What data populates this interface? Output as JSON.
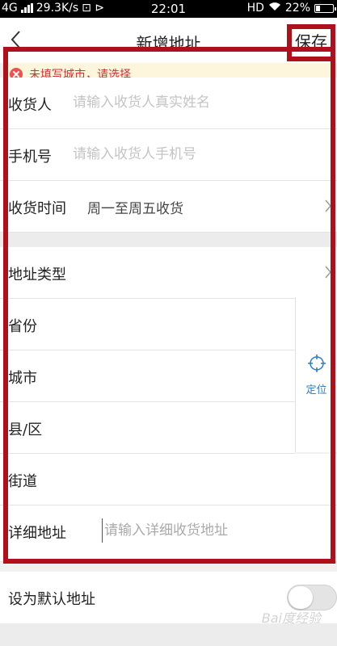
{
  "status_bar": {
    "network": "4G",
    "speed": "29.3K/s",
    "time": "22:01",
    "hd": "HD",
    "battery": "22%",
    "battery_level": 0.22
  },
  "nav": {
    "title": "新增地址",
    "save_label": "保存"
  },
  "error": {
    "message": "未填写城市，请选择"
  },
  "form": {
    "name": {
      "label": "收货人",
      "placeholder": "请输入收货人真实姓名"
    },
    "phone": {
      "label": "手机号",
      "placeholder": "请输入收货人手机号"
    },
    "delivery_time": {
      "label": "收货时间",
      "value": "周一至周五收货"
    },
    "address_type": {
      "label": "地址类型"
    },
    "province": {
      "label": "省份"
    },
    "city": {
      "label": "城市"
    },
    "district": {
      "label": "县/区"
    },
    "street": {
      "label": "街道"
    },
    "detail": {
      "label": "详细地址",
      "placeholder": "请输入详细收货地址"
    },
    "locate_label": "定位"
  },
  "default_address": {
    "label": "设为默认地址",
    "enabled": false
  },
  "watermark": "Bai度经验",
  "colors": {
    "highlight": "#b0101b",
    "error_text": "#cc3333",
    "locate": "#2a7cc7"
  }
}
